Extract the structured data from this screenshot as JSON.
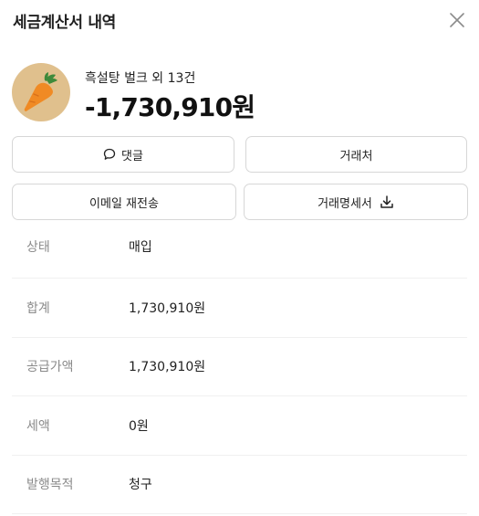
{
  "header": {
    "title": "세금계산서 내역",
    "close_icon": "close-icon"
  },
  "summary": {
    "avatar_icon": "carrot-icon",
    "item_name": "흑설탕 벌크 외 13건",
    "amount": "-1,730,910원"
  },
  "actions": {
    "comment_label": "댓글",
    "client_label": "거래처",
    "resend_email_label": "이메일 재전송",
    "statement_label": "거래명세서"
  },
  "details": [
    {
      "label": "상태",
      "value": "매입"
    },
    {
      "label": "합계",
      "value": "1,730,910원"
    },
    {
      "label": "공급가액",
      "value": "1,730,910원"
    },
    {
      "label": "세액",
      "value": "0원"
    },
    {
      "label": "발행목적",
      "value": "청구"
    }
  ],
  "colors": {
    "avatar_bg": "#e0c08d",
    "carrot": "#f08a24",
    "carrot_leaf": "#3e8a3a"
  }
}
